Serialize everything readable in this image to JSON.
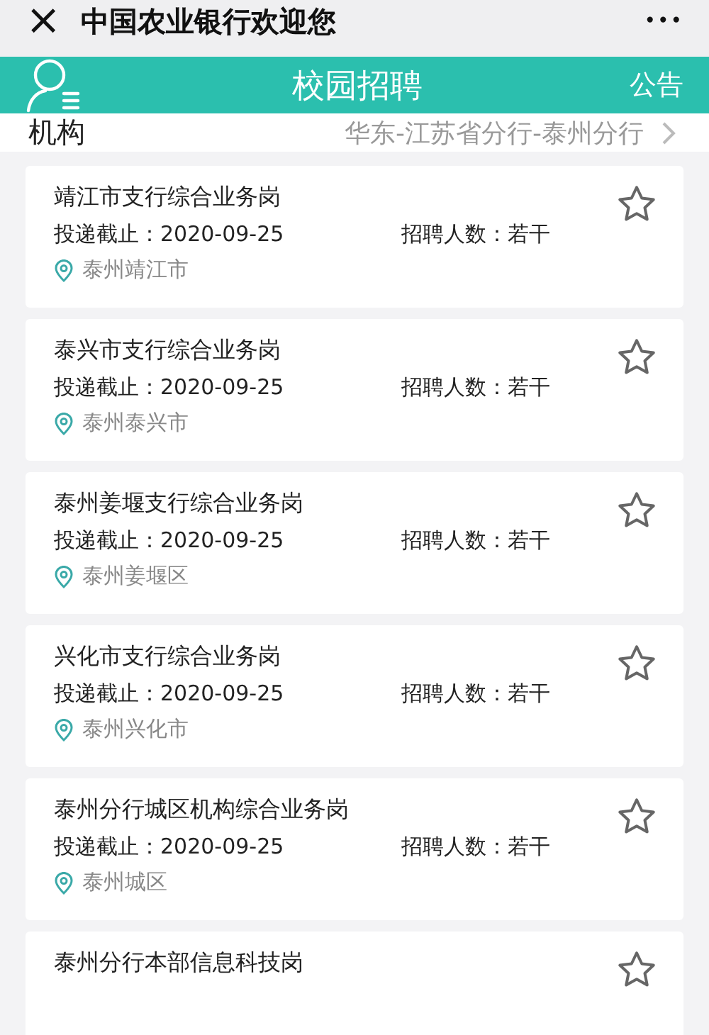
{
  "top_bar": {
    "close": "×",
    "title": "中国农业银行欢迎您",
    "more": "•••"
  },
  "header": {
    "title": "校园招聘",
    "action": "公告"
  },
  "org_row": {
    "label": "机构",
    "value": "华东-江苏省分行-泰州分行"
  },
  "jobs": [
    {
      "title": "靖江市支行综合业务岗",
      "deadline": "投递截止：2020-09-25",
      "headcount": "招聘人数：若干",
      "location": "泰州靖江市",
      "favorited": false
    },
    {
      "title": "泰兴市支行综合业务岗",
      "deadline": "投递截止：2020-09-25",
      "headcount": "招聘人数：若干",
      "location": "泰州泰兴市",
      "favorited": false
    },
    {
      "title": "泰州姜堰支行综合业务岗",
      "deadline": "投递截止：2020-09-25",
      "headcount": "招聘人数：若干",
      "location": "泰州姜堰区",
      "favorited": false
    },
    {
      "title": "兴化市支行综合业务岗",
      "deadline": "投递截止：2020-09-25",
      "headcount": "招聘人数：若干",
      "location": "泰州兴化市",
      "favorited": false
    },
    {
      "title": "泰州分行城区机构综合业务岗",
      "deadline": "投递截止：2020-09-25",
      "headcount": "招聘人数：若干",
      "location": "泰州城区",
      "favorited": false
    },
    {
      "title": "泰州分行本部信息科技岗",
      "favorited": false
    }
  ]
}
